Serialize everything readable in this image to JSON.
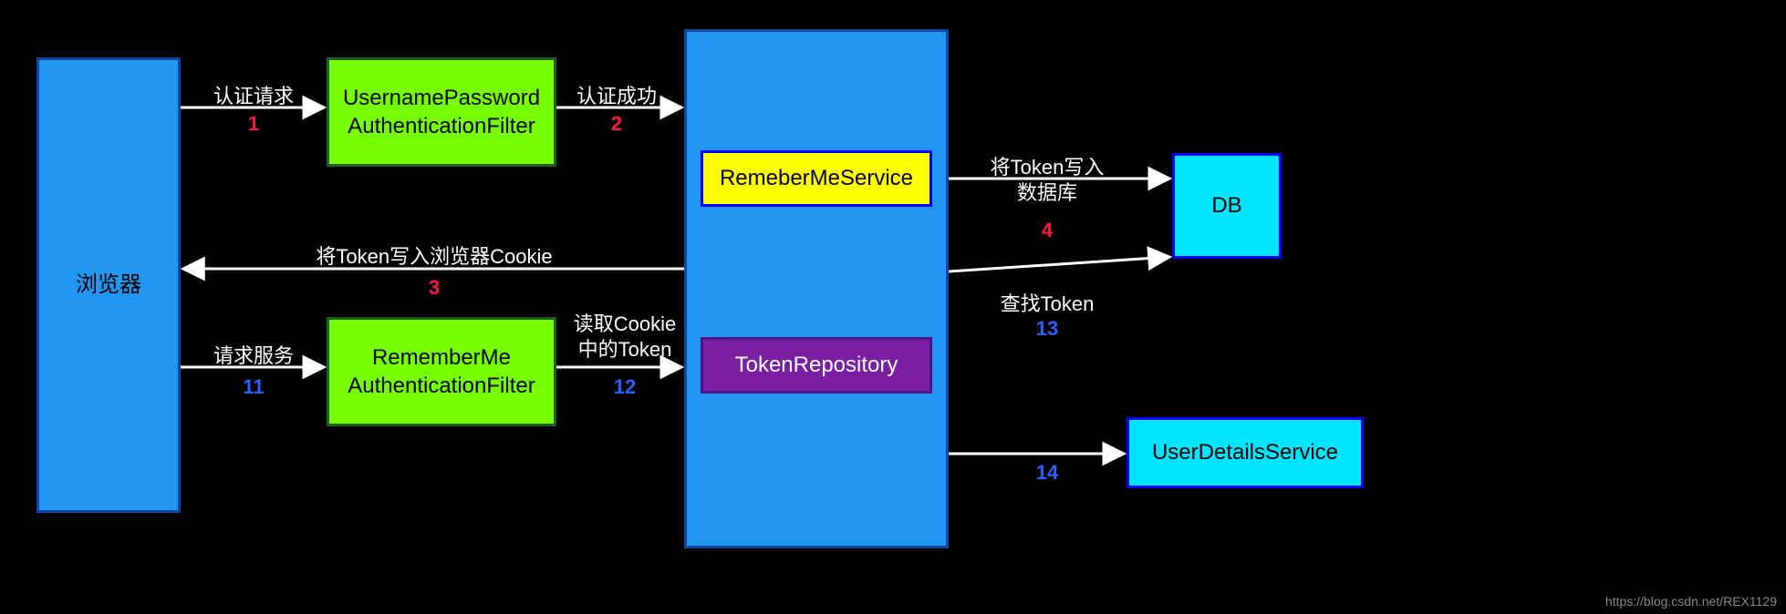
{
  "nodes": {
    "browser": "浏览器",
    "upFilter": "UsernamePassword\nAuthenticationFilter",
    "rmFilter": "RememberMe\nAuthenticationFilter",
    "rmService": "RemeberMeService",
    "tokenRepo": "TokenRepository",
    "db": "DB",
    "userDetails": "UserDetailsService",
    "mainBox": ""
  },
  "edges": {
    "e1": {
      "label": "认证请求",
      "step": "1"
    },
    "e2": {
      "label": "认证成功",
      "step": "2"
    },
    "e3": {
      "label": "将Token写入浏览器Cookie",
      "step": "3"
    },
    "e4": {
      "label": "将Token写入\n数据库",
      "step": "4"
    },
    "e11": {
      "label": "请求服务",
      "step": "11"
    },
    "e12": {
      "label": "读取Cookie\n中的Token",
      "step": "12"
    },
    "e13": {
      "label": "查找Token",
      "step": "13"
    },
    "e14": {
      "label": "",
      "step": "14"
    }
  },
  "watermark": "https://blog.csdn.net/REX1129"
}
